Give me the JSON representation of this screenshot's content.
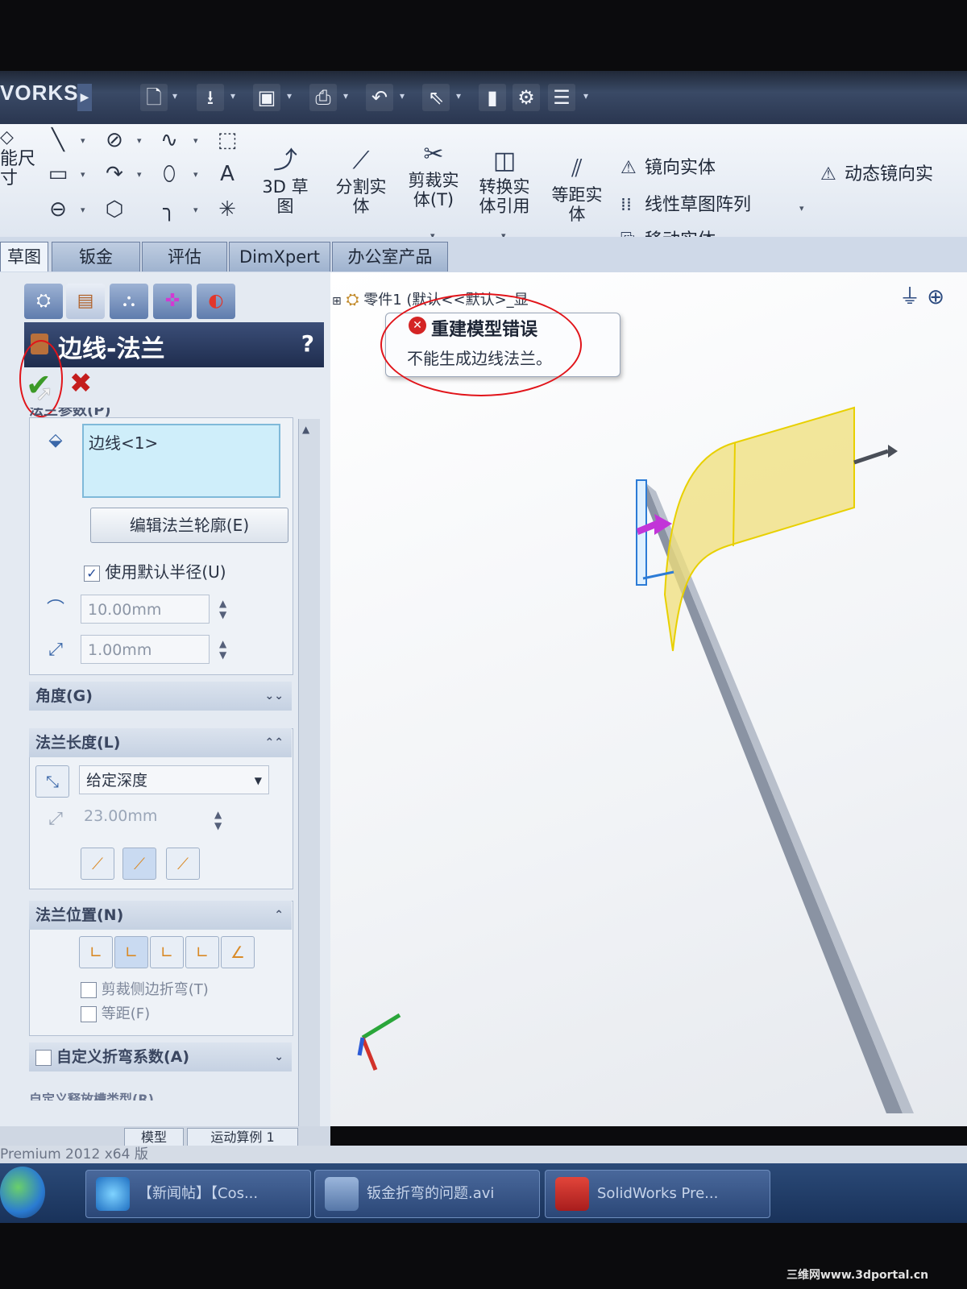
{
  "app": {
    "brand": "VORKS",
    "version_status": "Premium 2012 x64 版"
  },
  "quick_access": {
    "icons": [
      "new-document-icon",
      "open-folder-icon",
      "save-icon",
      "print-icon",
      "undo-icon",
      "select-arrow-icon",
      "rebuild-icon",
      "options-icon",
      "file-properties-icon"
    ]
  },
  "ribbon": {
    "left_labels": [
      "能尺",
      "寸",
      "草图"
    ],
    "big_tools": [
      {
        "label_line1": "3D 草图",
        "label_line2": "",
        "icon": "3d-sketch-icon"
      },
      {
        "label_line1": "分割实",
        "label_line2": "体",
        "icon": "split-entities-icon"
      },
      {
        "label_line1": "剪裁实",
        "label_line2": "体(T)",
        "icon": "trim-entities-icon"
      },
      {
        "label_line1": "转换实",
        "label_line2": "体引用",
        "icon": "convert-entities-icon"
      },
      {
        "label_line1": "等距实",
        "label_line2": "体",
        "icon": "offset-entities-icon"
      }
    ],
    "right_tools": {
      "mirror": "镜向实体",
      "linear_pattern": "线性草图阵列",
      "move": "移动实体",
      "dynamic_mirror": "动态镜向实"
    }
  },
  "command_tabs": {
    "sketch": "草图",
    "sheet_metal": "钣金",
    "evaluate": "评估",
    "dimxpert": "DimXpert",
    "office": "办公室产品"
  },
  "property_manager": {
    "title": "边线-法兰",
    "help": "?",
    "ok_symbol": "✔",
    "cancel_symbol": "✖",
    "params_header": "法兰参数(P)",
    "edge_value": "边线<1>",
    "edit_profile_button": "编辑法兰轮廓(E)",
    "use_default_radius": "使用默认半径(U)",
    "use_default_radius_checked": true,
    "radius_value": "10.00mm",
    "gap_value": "1.00mm",
    "angle_header": "角度(G)",
    "length_header": "法兰长度(L)",
    "end_condition": "给定深度",
    "length_value": "23.00mm",
    "position_header": "法兰位置(N)",
    "trim_side_bends": "剪裁侧边折弯(T)",
    "offset": "等距(F)",
    "custom_bend_allowance": "自定义折弯系数(A)",
    "custom_relief": "自定义释放槽类型(R)"
  },
  "viewport": {
    "tree_label": "零件1 (默认<<默认>_显",
    "error_title": "重建模型错误",
    "error_message": "不能生成边线法兰。"
  },
  "bottom_tabs": {
    "model": "模型",
    "motion": "运动算例 1"
  },
  "taskbar": {
    "items": [
      {
        "label": "【新闻帖】【Cos...",
        "icon": "internet-explorer-icon"
      },
      {
        "label": "钣金折弯的问题.avi",
        "icon": "video-file-icon"
      },
      {
        "label": "SolidWorks Pre...",
        "icon": "solidworks-icon"
      }
    ]
  },
  "watermark": "三维网www.3dportal.cn",
  "colors": {
    "title_bar": "#2a3650",
    "ribbon_bg": "#eaf0f7",
    "pm_title_bg": "#2b3b60",
    "error_red": "#d42424",
    "flange_preview": "#f0df7a",
    "annotation_red": "#e1141a"
  }
}
